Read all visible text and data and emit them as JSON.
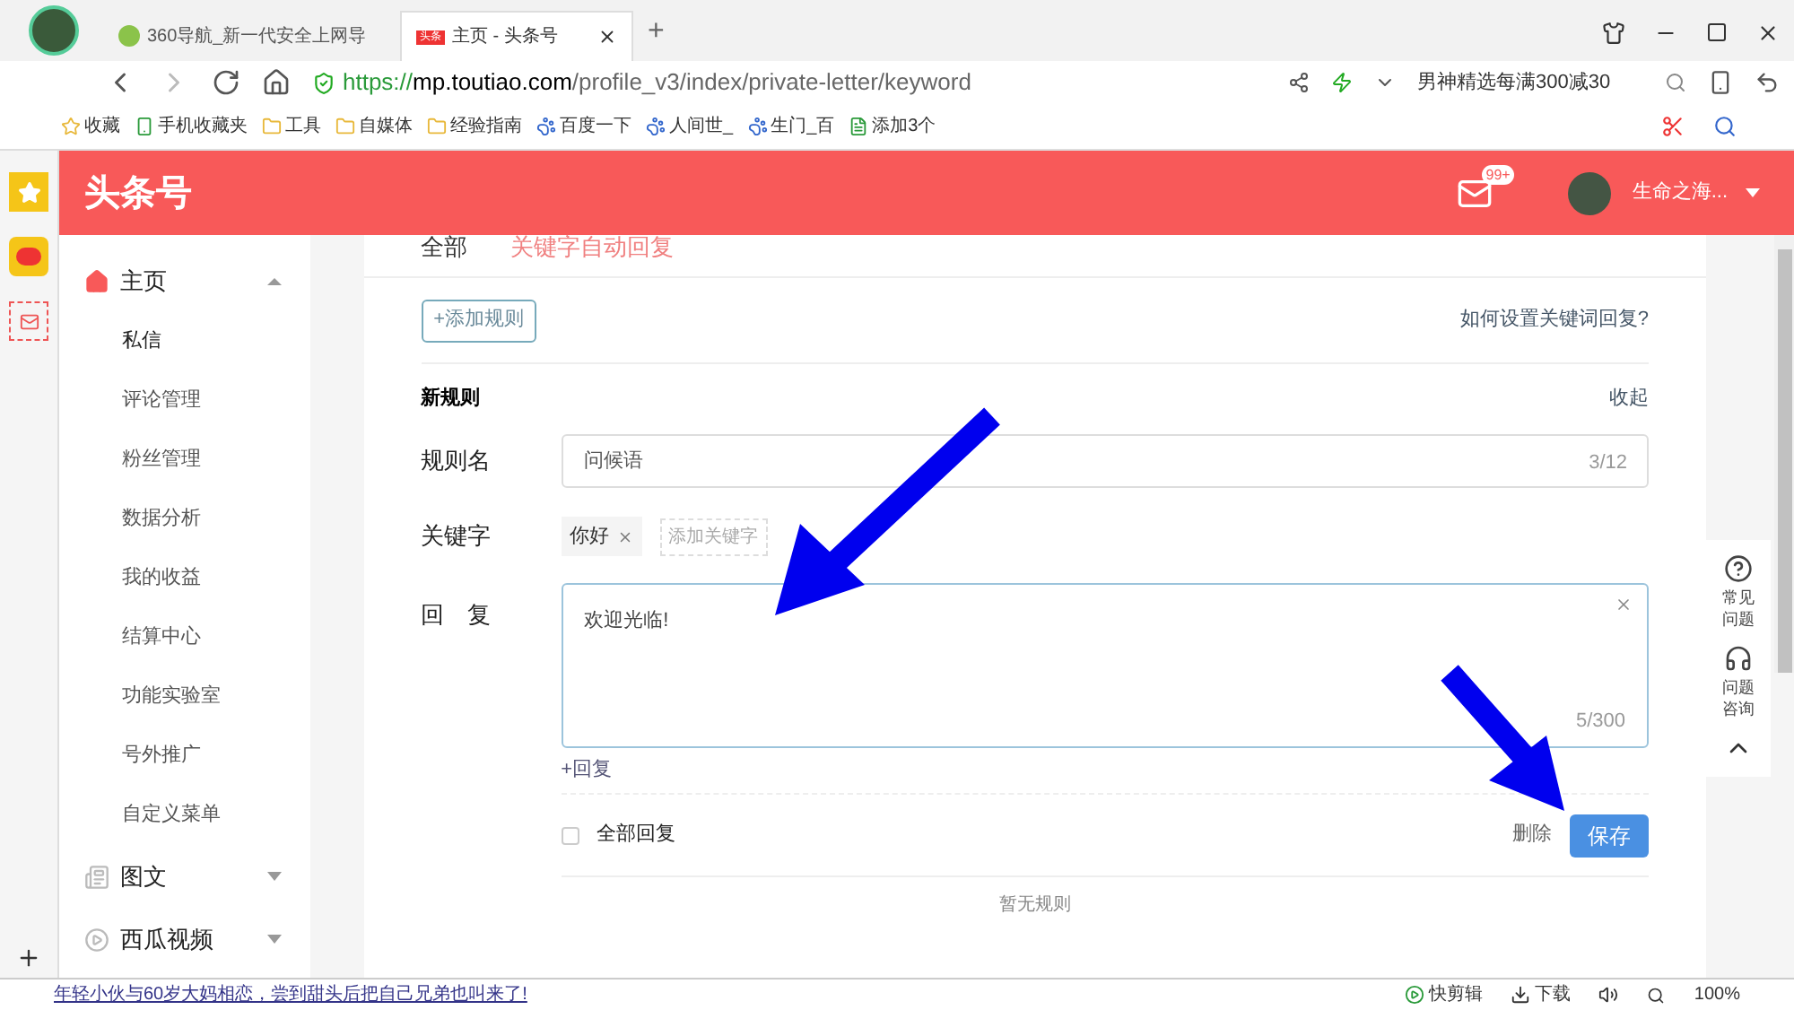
{
  "browser": {
    "tabs": [
      {
        "title": "360导航_新一代安全上网导",
        "selected": false
      },
      {
        "title": "主页 - 头条号",
        "badge": "头条",
        "selected": true
      }
    ],
    "new_tab": "+",
    "url_scheme": "https://",
    "url_host": "mp.toutiao.com",
    "url_path": "/profile_v3/index/private-letter/keyword",
    "search_text": "男神精选每满300减30",
    "bookmarks": [
      {
        "label": "收藏",
        "kind": "star"
      },
      {
        "label": "手机收藏夹",
        "kind": "phone"
      },
      {
        "label": "工具",
        "kind": "folder"
      },
      {
        "label": "自媒体",
        "kind": "folder"
      },
      {
        "label": "经验指南",
        "kind": "folder"
      },
      {
        "label": "百度一下",
        "kind": "paw"
      },
      {
        "label": "人间世_",
        "kind": "paw"
      },
      {
        "label": "生门_百",
        "kind": "paw"
      },
      {
        "label": "添加3个",
        "kind": "page"
      }
    ]
  },
  "header": {
    "logo": "头条号",
    "mail_badge": "99+",
    "user_name": "生命之海..."
  },
  "sidebar": [
    {
      "label": "主页",
      "kind": "home",
      "expanded": true,
      "children": [
        {
          "label": "私信",
          "selected": true
        },
        {
          "label": "评论管理",
          "selected": false
        },
        {
          "label": "粉丝管理",
          "selected": false
        },
        {
          "label": "数据分析",
          "selected": false
        },
        {
          "label": "我的收益",
          "selected": false
        },
        {
          "label": "结算中心",
          "selected": false
        },
        {
          "label": "功能实验室",
          "selected": false
        },
        {
          "label": "号外推广",
          "selected": false
        },
        {
          "label": "自定义菜单",
          "selected": false
        }
      ]
    },
    {
      "label": "图文",
      "kind": "article",
      "expanded": false
    },
    {
      "label": "西瓜视频",
      "kind": "video",
      "expanded": false
    }
  ],
  "tabs": [
    {
      "label": "全部",
      "selected": false
    },
    {
      "label": "关键字自动回复",
      "selected": true
    }
  ],
  "add_rule": "+添加规则",
  "help_link": "如何设置关键词回复?",
  "rule": {
    "title": "新规则",
    "collapse": "收起",
    "name_label": "规则名",
    "name_placeholder": "问候语",
    "name_count": "3/12",
    "keyword_label": "关键字",
    "keywords": [
      "你好"
    ],
    "add_keyword": "添加关键字",
    "reply_label": "回　复",
    "reply_value": "欢迎光临!",
    "reply_count": "5/300",
    "add_reply": "+回复",
    "reply_all": {
      "label": "全部回复",
      "checked": false
    },
    "delete": "删除",
    "save": "保存"
  },
  "empty": "暂无规则",
  "float_panel": [
    {
      "label": "常见问题",
      "kind": "question"
    },
    {
      "label": "问题咨询",
      "kind": "headset"
    }
  ],
  "status": {
    "news": "年轻小伙与60岁大妈相恋，尝到甜头后把自己兄弟也叫来了!",
    "items": [
      "快剪辑",
      "下载"
    ],
    "zoom": "100%"
  }
}
